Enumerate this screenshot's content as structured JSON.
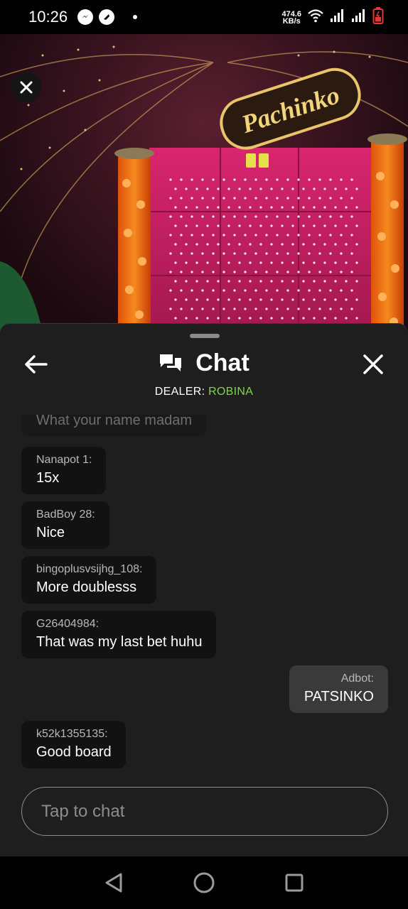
{
  "status_bar": {
    "time": "10:26",
    "net_speed_value": "474.6",
    "net_speed_unit": "KB/s",
    "icons": [
      "messenger-icon",
      "app-icon",
      "notification-dot",
      "wifi-icon",
      "signal-icon",
      "signal-icon",
      "battery-icon"
    ],
    "battery_color": "#e53935"
  },
  "video": {
    "sign_text": "Pachinko",
    "close_icon": "close-icon"
  },
  "chat": {
    "title": "Chat",
    "dealer_label": "DEALER:",
    "dealer_name": "ROBINA",
    "dealer_color": "#7cd84a",
    "input_placeholder": "Tap to chat",
    "messages": [
      {
        "sender": "",
        "text": "What your name madam",
        "self": false,
        "faded": true
      },
      {
        "sender": "Nanapot 1:",
        "text": "15x",
        "self": false
      },
      {
        "sender": "BadBoy 28:",
        "text": "Nice",
        "self": false
      },
      {
        "sender": "bingoplusvsijhg_108:",
        "text": "More doublesss",
        "self": false
      },
      {
        "sender": "G26404984:",
        "text": "That was my last bet huhu",
        "self": false
      },
      {
        "sender": "Adbot:",
        "text": "PATSINKO",
        "self": true
      },
      {
        "sender": "k52k1355135:",
        "text": "Good board",
        "self": false
      }
    ]
  },
  "nav_bar": {
    "buttons": [
      "back-icon",
      "home-icon",
      "recents-icon"
    ]
  }
}
